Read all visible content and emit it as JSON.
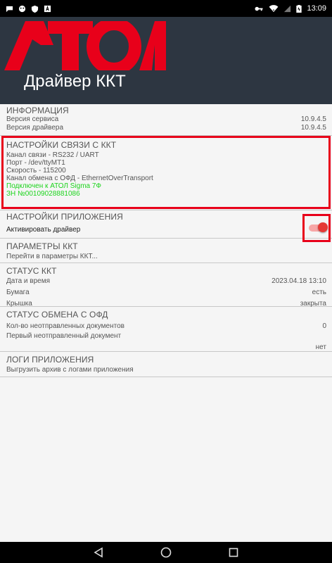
{
  "status_bar": {
    "time": "13:09",
    "left_icons": [
      "chat-icon",
      "android-icon",
      "shield-icon",
      "a-notification-icon"
    ],
    "right_icons": [
      "key-icon",
      "wifi-icon",
      "signal-icon",
      "battery-icon"
    ]
  },
  "header": {
    "logo_text": "АТОЛ",
    "title": "Драйвер ККТ",
    "background": "#2d3641",
    "logo_color": "#e8001a"
  },
  "sections": {
    "info": {
      "title": "ИНФОРМАЦИЯ",
      "rows": [
        {
          "label": "Версия сервиса",
          "value": "10.9.4.5"
        },
        {
          "label": "Версия драйвера",
          "value": "10.9.4.5"
        }
      ]
    },
    "connection": {
      "title": "НАСТРОЙКИ СВЯЗИ С ККТ",
      "lines": [
        "Канал связи - RS232 / UART",
        "Порт - /dev/ttyMT1",
        "Скорость - 115200",
        "Канал обмена с ОФД - EthernetOverTransport"
      ],
      "status_lines": [
        "Подключен к АТОЛ Sigma 7Ф",
        "ЗН №00109028881086"
      ]
    },
    "app_settings": {
      "title": "НАСТРОЙКИ ПРИЛОЖЕНИЯ",
      "activate_label": "Активировать драйвер",
      "activate_enabled": true
    },
    "kkt_params": {
      "title": "ПАРАМЕТРЫ ККТ",
      "link": "Перейти в параметры ККТ..."
    },
    "kkt_status": {
      "title": "СТАТУС ККТ",
      "rows": [
        {
          "label": "Дата и время",
          "value": "2023.04.18 13:10"
        },
        {
          "label": "Бумага",
          "value": "есть"
        },
        {
          "label": "Крышка",
          "value": "закрыта"
        }
      ]
    },
    "ofd_status": {
      "title": "СТАТУС ОБМЕНА С ОФД",
      "rows": [
        {
          "label": "Кол-во неотправленных документов",
          "value": "0"
        },
        {
          "label": "Первый неотправленный документ",
          "value": ""
        }
      ],
      "first_doc_value": "нет"
    },
    "logs": {
      "title": "ЛОГИ ПРИЛОЖЕНИЯ",
      "link": "Выгрузить архив с логами приложения"
    }
  },
  "colors": {
    "accent_red": "#e8001a",
    "connected_green": "#1cd41c",
    "toggle_on": "#e53935"
  },
  "nav_bar": {
    "buttons": [
      "back-icon",
      "home-icon",
      "recents-icon"
    ]
  }
}
